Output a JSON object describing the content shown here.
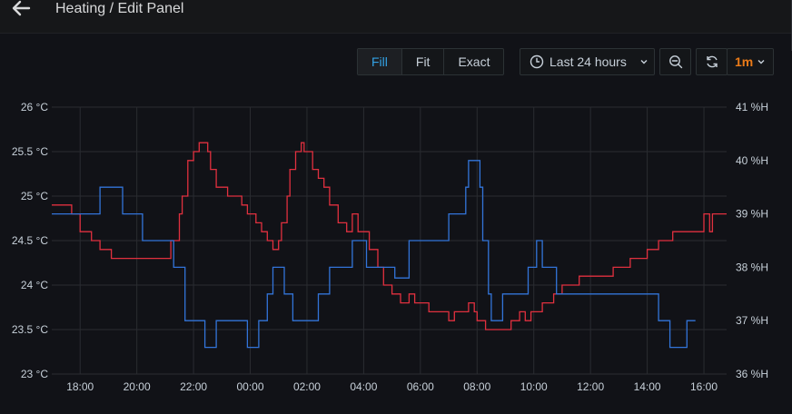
{
  "header": {
    "title": "Heating / Edit Panel",
    "back_icon": "arrow-left-icon"
  },
  "toolbar": {
    "modes": [
      {
        "label": "Fill",
        "active": true
      },
      {
        "label": "Fit",
        "active": false
      },
      {
        "label": "Exact",
        "active": false
      }
    ],
    "time_range_label": "Last 24 hours",
    "refresh_interval": "1m",
    "icons": {
      "clock": "clock-icon",
      "dropdown": "chevron-down-icon",
      "zoom_out": "zoom-out-icon",
      "refresh": "refresh-icon"
    },
    "accent_color": "#33a2e5",
    "interval_color": "#eb7b18"
  },
  "chart_data": {
    "type": "line",
    "x_ticks": [
      "18:00",
      "20:00",
      "22:00",
      "00:00",
      "02:00",
      "04:00",
      "06:00",
      "08:00",
      "10:00",
      "12:00",
      "14:00",
      "16:00"
    ],
    "y_left_ticks": [
      "23 °C",
      "23.5 °C",
      "24 °C",
      "24.5 °C",
      "25 °C",
      "25.5 °C",
      "26 °C"
    ],
    "y_right_ticks": [
      "36 %H",
      "37 %H",
      "38 %H",
      "39 %H",
      "40 %H",
      "41 %H"
    ],
    "y_left_range": [
      23,
      26
    ],
    "y_right_range": [
      36,
      41
    ],
    "x_range_hours": [
      17.0,
      40.8
    ],
    "grid": true,
    "legend": "none",
    "series": [
      {
        "axis": "left",
        "color": "#e0303f",
        "points": [
          [
            17.0,
            24.9
          ],
          [
            17.7,
            24.9
          ],
          [
            17.7,
            24.8
          ],
          [
            18.0,
            24.8
          ],
          [
            18.0,
            24.6
          ],
          [
            18.4,
            24.6
          ],
          [
            18.4,
            24.5
          ],
          [
            18.7,
            24.5
          ],
          [
            18.7,
            24.4
          ],
          [
            19.1,
            24.4
          ],
          [
            19.1,
            24.3
          ],
          [
            21.2,
            24.3
          ],
          [
            21.2,
            24.5
          ],
          [
            21.5,
            24.5
          ],
          [
            21.5,
            24.8
          ],
          [
            21.6,
            24.8
          ],
          [
            21.6,
            25.0
          ],
          [
            21.8,
            25.0
          ],
          [
            21.8,
            25.4
          ],
          [
            22.0,
            25.4
          ],
          [
            22.0,
            25.5
          ],
          [
            22.2,
            25.5
          ],
          [
            22.2,
            25.6
          ],
          [
            22.5,
            25.6
          ],
          [
            22.5,
            25.5
          ],
          [
            22.6,
            25.5
          ],
          [
            22.6,
            25.3
          ],
          [
            22.8,
            25.3
          ],
          [
            22.8,
            25.1
          ],
          [
            23.2,
            25.1
          ],
          [
            23.2,
            25.0
          ],
          [
            23.7,
            25.0
          ],
          [
            23.7,
            24.9
          ],
          [
            23.9,
            24.9
          ],
          [
            23.9,
            24.8
          ],
          [
            24.2,
            24.8
          ],
          [
            24.2,
            24.7
          ],
          [
            24.4,
            24.7
          ],
          [
            24.4,
            24.6
          ],
          [
            24.6,
            24.6
          ],
          [
            24.6,
            24.5
          ],
          [
            24.8,
            24.5
          ],
          [
            24.8,
            24.4
          ],
          [
            25.0,
            24.4
          ],
          [
            25.0,
            24.5
          ],
          [
            25.1,
            24.5
          ],
          [
            25.1,
            24.7
          ],
          [
            25.3,
            24.7
          ],
          [
            25.3,
            25.0
          ],
          [
            25.4,
            25.0
          ],
          [
            25.4,
            25.3
          ],
          [
            25.6,
            25.3
          ],
          [
            25.6,
            25.5
          ],
          [
            25.8,
            25.5
          ],
          [
            25.8,
            25.6
          ],
          [
            25.9,
            25.6
          ],
          [
            25.9,
            25.5
          ],
          [
            26.2,
            25.5
          ],
          [
            26.2,
            25.3
          ],
          [
            26.4,
            25.3
          ],
          [
            26.4,
            25.2
          ],
          [
            26.6,
            25.2
          ],
          [
            26.6,
            25.1
          ],
          [
            26.8,
            25.1
          ],
          [
            26.8,
            24.9
          ],
          [
            27.1,
            24.9
          ],
          [
            27.1,
            24.7
          ],
          [
            27.4,
            24.7
          ],
          [
            27.4,
            24.6
          ],
          [
            27.6,
            24.6
          ],
          [
            27.6,
            24.8
          ],
          [
            27.8,
            24.8
          ],
          [
            27.8,
            24.6
          ],
          [
            28.2,
            24.6
          ],
          [
            28.2,
            24.4
          ],
          [
            28.5,
            24.4
          ],
          [
            28.5,
            24.2
          ],
          [
            28.7,
            24.2
          ],
          [
            28.7,
            24.0
          ],
          [
            29.0,
            24.0
          ],
          [
            29.0,
            23.9
          ],
          [
            29.3,
            23.9
          ],
          [
            29.3,
            23.8
          ],
          [
            29.6,
            23.8
          ],
          [
            29.6,
            23.9
          ],
          [
            29.8,
            23.9
          ],
          [
            29.8,
            23.8
          ],
          [
            30.3,
            23.8
          ],
          [
            30.3,
            23.7
          ],
          [
            31.0,
            23.7
          ],
          [
            31.0,
            23.6
          ],
          [
            31.2,
            23.6
          ],
          [
            31.2,
            23.7
          ],
          [
            31.7,
            23.7
          ],
          [
            31.7,
            23.8
          ],
          [
            31.9,
            23.8
          ],
          [
            31.9,
            23.7
          ],
          [
            32.0,
            23.7
          ],
          [
            32.0,
            23.6
          ],
          [
            32.3,
            23.6
          ],
          [
            32.3,
            23.5
          ],
          [
            33.2,
            23.5
          ],
          [
            33.2,
            23.6
          ],
          [
            33.5,
            23.6
          ],
          [
            33.5,
            23.7
          ],
          [
            33.7,
            23.7
          ],
          [
            33.7,
            23.6
          ],
          [
            33.9,
            23.6
          ],
          [
            33.9,
            23.7
          ],
          [
            34.3,
            23.7
          ],
          [
            34.3,
            23.8
          ],
          [
            34.7,
            23.8
          ],
          [
            34.7,
            23.9
          ],
          [
            35.0,
            23.9
          ],
          [
            35.0,
            24.0
          ],
          [
            35.6,
            24.0
          ],
          [
            35.6,
            24.1
          ],
          [
            36.8,
            24.1
          ],
          [
            36.8,
            24.2
          ],
          [
            37.4,
            24.2
          ],
          [
            37.4,
            24.3
          ],
          [
            38.0,
            24.3
          ],
          [
            38.0,
            24.4
          ],
          [
            38.4,
            24.4
          ],
          [
            38.4,
            24.5
          ],
          [
            38.9,
            24.5
          ],
          [
            38.9,
            24.6
          ],
          [
            40.0,
            24.6
          ],
          [
            40.0,
            24.8
          ],
          [
            40.2,
            24.8
          ],
          [
            40.2,
            24.6
          ],
          [
            40.3,
            24.6
          ],
          [
            40.3,
            24.8
          ],
          [
            40.8,
            24.8
          ]
        ]
      },
      {
        "axis": "right",
        "color": "#3274d9",
        "points": [
          [
            17.0,
            39.0
          ],
          [
            18.7,
            39.0
          ],
          [
            18.7,
            39.5
          ],
          [
            19.5,
            39.5
          ],
          [
            19.5,
            39.0
          ],
          [
            20.2,
            39.0
          ],
          [
            20.2,
            38.5
          ],
          [
            21.3,
            38.5
          ],
          [
            21.3,
            38.0
          ],
          [
            21.7,
            38.0
          ],
          [
            21.7,
            37.0
          ],
          [
            22.4,
            37.0
          ],
          [
            22.4,
            36.5
          ],
          [
            22.8,
            36.5
          ],
          [
            22.8,
            37.0
          ],
          [
            23.9,
            37.0
          ],
          [
            23.9,
            36.5
          ],
          [
            24.3,
            36.5
          ],
          [
            24.3,
            37.0
          ],
          [
            24.6,
            37.0
          ],
          [
            24.6,
            37.5
          ],
          [
            24.8,
            37.5
          ],
          [
            24.8,
            38.0
          ],
          [
            25.2,
            38.0
          ],
          [
            25.2,
            37.5
          ],
          [
            25.5,
            37.5
          ],
          [
            25.5,
            37.0
          ],
          [
            26.4,
            37.0
          ],
          [
            26.4,
            37.5
          ],
          [
            26.8,
            37.5
          ],
          [
            26.8,
            38.0
          ],
          [
            27.6,
            38.0
          ],
          [
            27.6,
            38.5
          ],
          [
            28.1,
            38.5
          ],
          [
            28.1,
            38.0
          ],
          [
            29.1,
            38.0
          ],
          [
            29.1,
            37.8
          ],
          [
            29.6,
            37.8
          ],
          [
            29.6,
            38.5
          ],
          [
            31.0,
            38.5
          ],
          [
            31.0,
            39.0
          ],
          [
            31.6,
            39.0
          ],
          [
            31.6,
            39.5
          ],
          [
            31.7,
            39.5
          ],
          [
            31.7,
            40.0
          ],
          [
            32.1,
            40.0
          ],
          [
            32.1,
            39.5
          ],
          [
            32.2,
            39.5
          ],
          [
            32.2,
            38.5
          ],
          [
            32.4,
            38.5
          ],
          [
            32.4,
            37.5
          ],
          [
            32.5,
            37.5
          ],
          [
            32.5,
            37.0
          ],
          [
            32.9,
            37.0
          ],
          [
            32.9,
            37.5
          ],
          [
            33.8,
            37.5
          ],
          [
            33.8,
            38.0
          ],
          [
            34.1,
            38.0
          ],
          [
            34.1,
            38.5
          ],
          [
            34.3,
            38.5
          ],
          [
            34.3,
            38.0
          ],
          [
            34.8,
            38.0
          ],
          [
            34.8,
            37.5
          ],
          [
            38.4,
            37.5
          ],
          [
            38.4,
            37.0
          ],
          [
            38.8,
            37.0
          ],
          [
            38.8,
            36.5
          ],
          [
            39.4,
            36.5
          ],
          [
            39.4,
            37.0
          ],
          [
            39.7,
            37.0
          ]
        ]
      }
    ]
  }
}
